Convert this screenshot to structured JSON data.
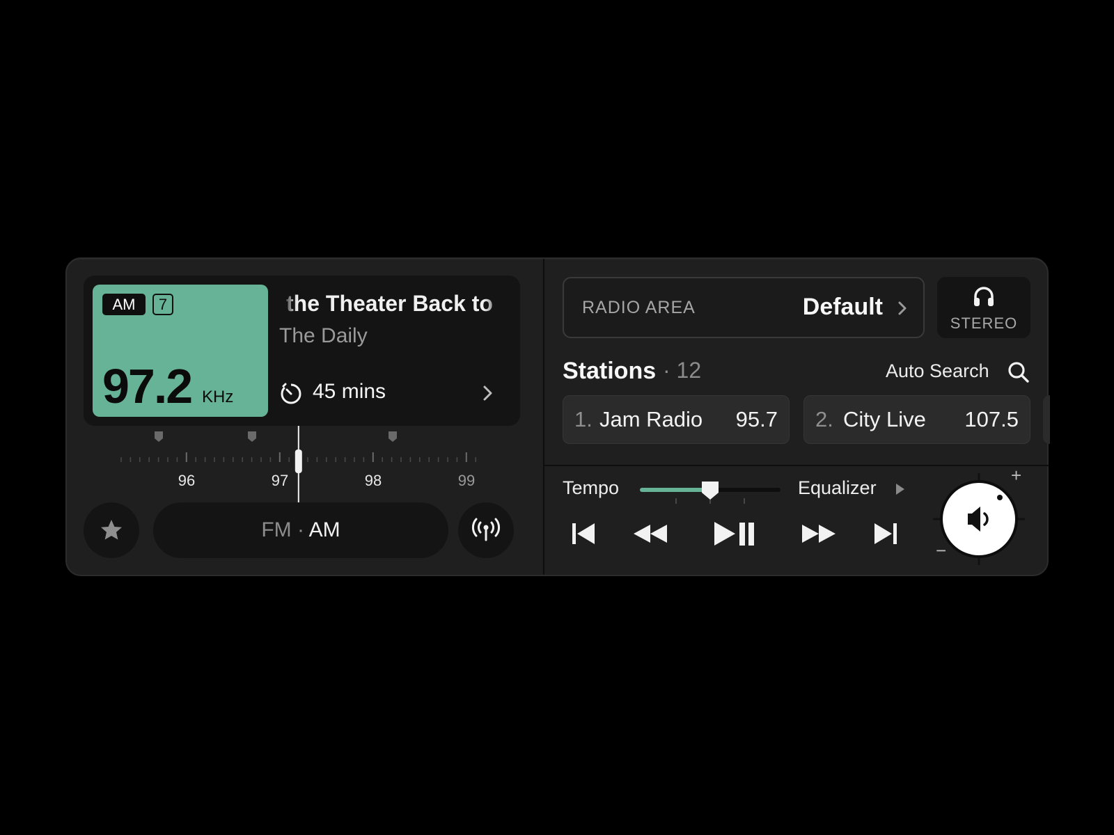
{
  "now_playing": {
    "band": "AM",
    "preset": "7",
    "frequency": "97.2",
    "unit": "KHz",
    "title": "the Theater Back to",
    "show": "The Daily",
    "timer": "45 mins"
  },
  "tuner": {
    "labels": [
      "96",
      "97",
      "98",
      "99"
    ],
    "current": 97.2
  },
  "band_switch": {
    "fm": "FM",
    "separator": "·",
    "am": "AM",
    "selected": "AM"
  },
  "radio_area": {
    "label": "RADIO AREA",
    "value": "Default"
  },
  "audio_mode": {
    "label": "STEREO"
  },
  "stations": {
    "title": "Stations",
    "count": "· 12",
    "auto_search": "Auto Search",
    "items": [
      {
        "num": "1.",
        "name": "Jam Radio",
        "freq": "95.7"
      },
      {
        "num": "2.",
        "name": "City Live",
        "freq": "107.5"
      }
    ]
  },
  "controls": {
    "tempo_label": "Tempo",
    "tempo_level": 0.5,
    "equalizer_label": "Equalizer",
    "volume_plus": "+",
    "volume_minus": "−"
  },
  "colors": {
    "accent": "#67b397",
    "panel": "#1f1f1f",
    "card": "#141414"
  },
  "icons": [
    "favorite-star-icon",
    "broadcast-icon",
    "timer-icon",
    "chevron-right-icon",
    "headphones-icon",
    "search-icon",
    "skip-back-icon",
    "rewind-icon",
    "play-pause-icon",
    "fast-forward-icon",
    "skip-forward-icon",
    "speaker-icon"
  ]
}
